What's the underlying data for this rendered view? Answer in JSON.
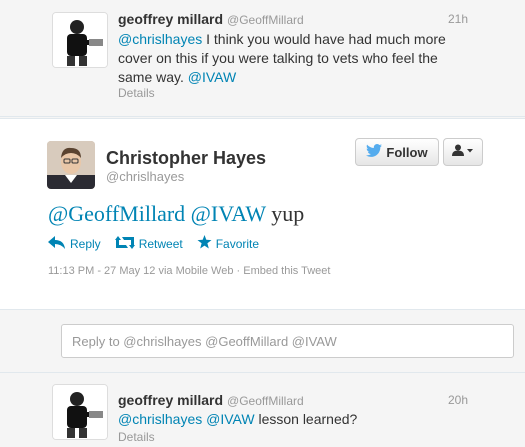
{
  "tweet_top": {
    "name": "geoffrey millard",
    "handle": "@GeoffMillard",
    "time": "21h",
    "mention": "@chrislhayes",
    "text": " I think you would have had much more cover on this if you were talking to vets who feel the same way. ",
    "hashtag": "@IVAW",
    "details": "Details"
  },
  "main_tweet": {
    "name": "Christopher Hayes",
    "handle": "@chrislhayes",
    "follow_label": "Follow",
    "mention1": "@GeoffMillard",
    "mention2": "@IVAW",
    "text_tail": " yup",
    "actions": {
      "reply": "Reply",
      "retweet": "Retweet",
      "favorite": "Favorite"
    },
    "meta": "11:13 PM - 27 May 12 via Mobile Web · Embed this Tweet"
  },
  "reply_box": {
    "placeholder": "Reply to @chrislhayes @GeoffMillard @IVAW"
  },
  "tweet_bottom": {
    "name": "geoffrey millard",
    "handle": "@GeoffMillard",
    "time": "20h",
    "mention1": "@chrislhayes",
    "mention2": "@IVAW",
    "text_tail": " lesson learned?",
    "details": "Details"
  },
  "colors": {
    "link": "#0084b4",
    "background": "#f5f5f5"
  }
}
